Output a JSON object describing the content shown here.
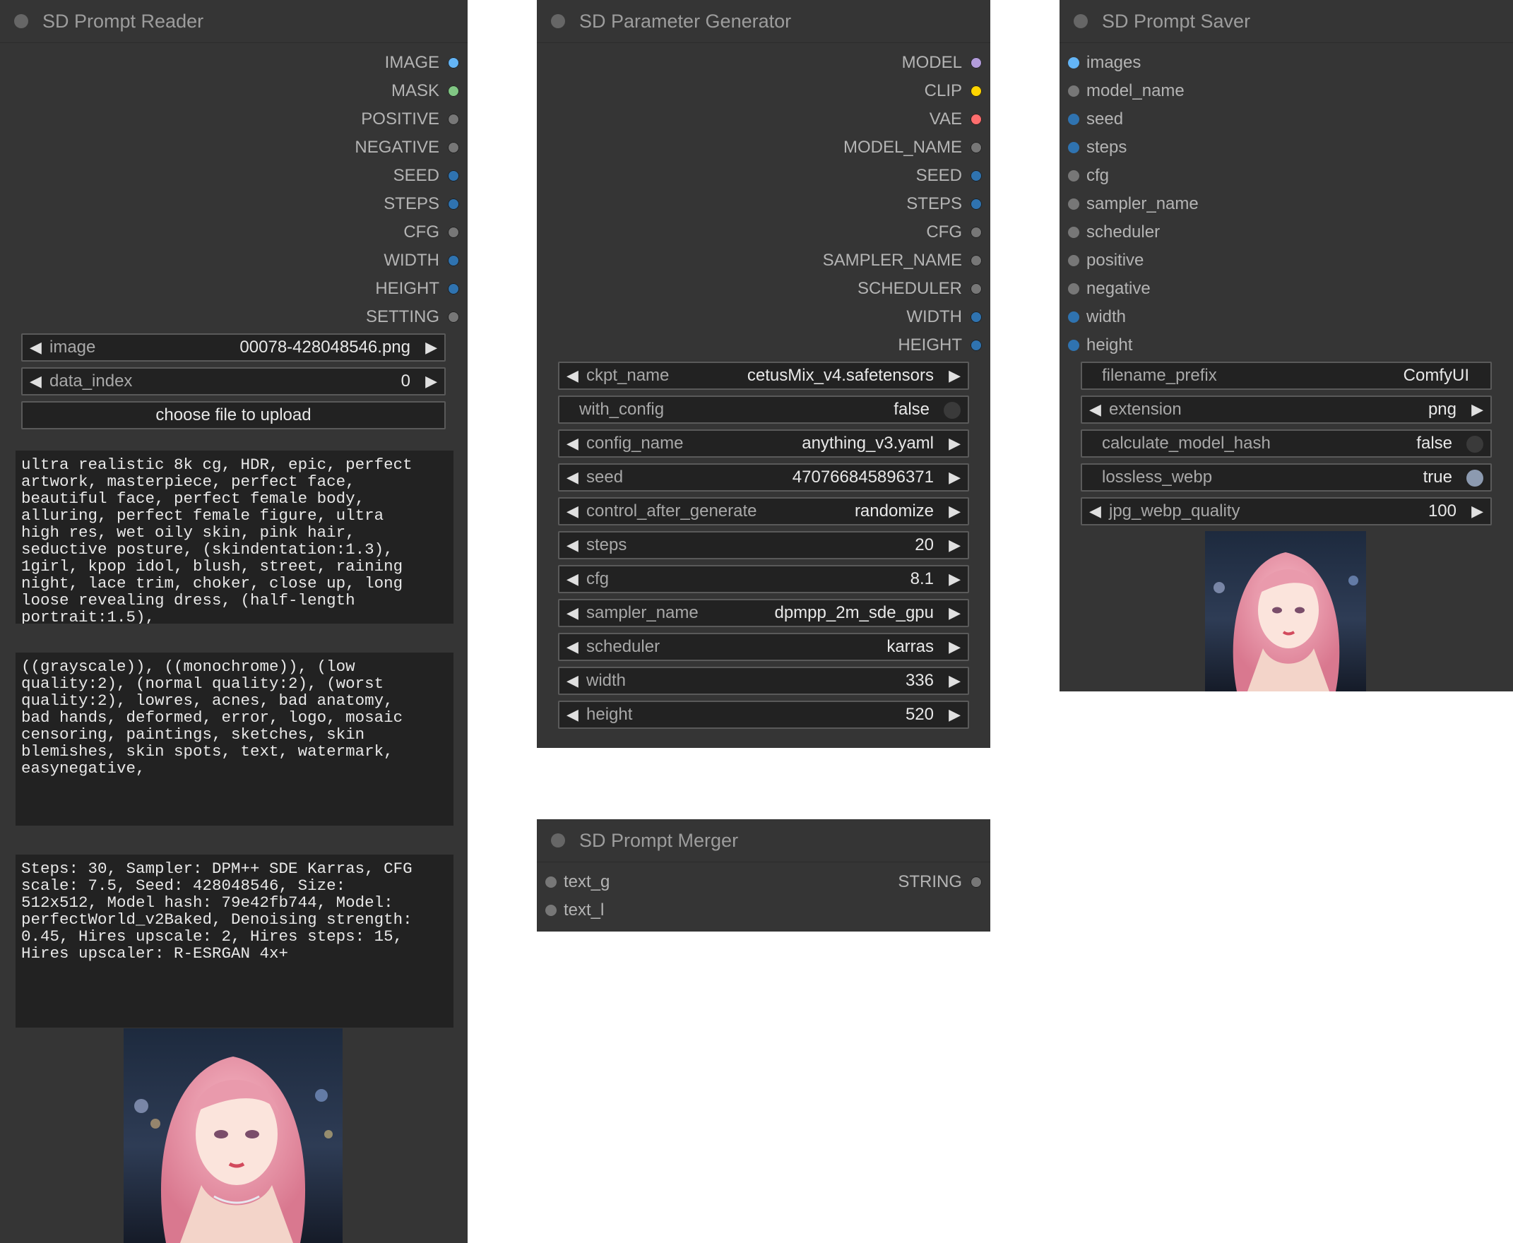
{
  "reader": {
    "title": "SD Prompt Reader",
    "outputs": [
      {
        "label": "IMAGE",
        "color": "#64b5f6"
      },
      {
        "label": "MASK",
        "color": "#81c784"
      },
      {
        "label": "POSITIVE",
        "color": "#777777"
      },
      {
        "label": "NEGATIVE",
        "color": "#777777"
      },
      {
        "label": "SEED",
        "color": "#2f73b0"
      },
      {
        "label": "STEPS",
        "color": "#2f73b0"
      },
      {
        "label": "CFG",
        "color": "#777777"
      },
      {
        "label": "WIDTH",
        "color": "#2f73b0"
      },
      {
        "label": "HEIGHT",
        "color": "#2f73b0"
      },
      {
        "label": "SETTING",
        "color": "#777777"
      }
    ],
    "widgets": {
      "image": {
        "name": "image",
        "value": "00078-428048546.png"
      },
      "data_index": {
        "name": "data_index",
        "value": "0"
      },
      "upload_label": "choose file to upload"
    },
    "positive_text": "ultra realistic 8k cg, HDR, epic, perfect\nartwork, masterpiece, perfect face,\nbeautiful face, perfect female body,\nalluring, perfect female figure, ultra\nhigh res, wet oily skin, pink hair,\nseductive posture, (skindentation:1.3),\n1girl, kpop idol, blush, street, raining\nnight, lace trim, choker, close up, long\nloose revealing dress, (half-length\nportrait:1.5),",
    "negative_text": "((grayscale)), ((monochrome)), (low\nquality:2), (normal quality:2), (worst\nquality:2), lowres, acnes, bad anatomy,\nbad hands, deformed, error, logo, mosaic\ncensoring, paintings, sketches, skin\nblemishes, skin spots, text, watermark,\neasynegative,",
    "settings_text": "Steps: 30, Sampler: DPM++ SDE Karras, CFG\nscale: 7.5, Seed: 428048546, Size:\n512x512, Model hash: 79e42fb744, Model:\nperfectWorld_v2Baked, Denoising strength:\n0.45, Hires upscale: 2, Hires steps: 15,\nHires upscaler: R-ESRGAN 4x+"
  },
  "generator": {
    "title": "SD Parameter Generator",
    "outputs": [
      {
        "label": "MODEL",
        "color": "#b39ddb"
      },
      {
        "label": "CLIP",
        "color": "#ffd500"
      },
      {
        "label": "VAE",
        "color": "#ff6e6e"
      },
      {
        "label": "MODEL_NAME",
        "color": "#777777"
      },
      {
        "label": "SEED",
        "color": "#2f73b0"
      },
      {
        "label": "STEPS",
        "color": "#2f73b0"
      },
      {
        "label": "CFG",
        "color": "#777777"
      },
      {
        "label": "SAMPLER_NAME",
        "color": "#777777"
      },
      {
        "label": "SCHEDULER",
        "color": "#777777"
      },
      {
        "label": "WIDTH",
        "color": "#2f73b0"
      },
      {
        "label": "HEIGHT",
        "color": "#2f73b0"
      }
    ],
    "widgets": [
      {
        "kind": "combo",
        "name": "ckpt_name",
        "value": "cetusMix_v4.safetensors"
      },
      {
        "kind": "toggle",
        "name": "with_config",
        "value": "false",
        "on": false
      },
      {
        "kind": "combo",
        "name": "config_name",
        "value": "anything_v3.yaml"
      },
      {
        "kind": "combo",
        "name": "seed",
        "value": "470766845896371"
      },
      {
        "kind": "combo",
        "name": "control_after_generate",
        "value": "randomize"
      },
      {
        "kind": "combo",
        "name": "steps",
        "value": "20"
      },
      {
        "kind": "combo",
        "name": "cfg",
        "value": "8.1"
      },
      {
        "kind": "combo",
        "name": "sampler_name",
        "value": "dpmpp_2m_sde_gpu"
      },
      {
        "kind": "combo",
        "name": "scheduler",
        "value": "karras"
      },
      {
        "kind": "combo",
        "name": "width",
        "value": "336"
      },
      {
        "kind": "combo",
        "name": "height",
        "value": "520"
      }
    ]
  },
  "merger": {
    "title": "SD Prompt Merger",
    "inputs": [
      {
        "label": "text_g",
        "color": "#777777"
      },
      {
        "label": "text_l",
        "color": "#777777"
      }
    ],
    "output": {
      "label": "STRING",
      "color": "#777777"
    }
  },
  "saver": {
    "title": "SD Prompt Saver",
    "inputs": [
      {
        "label": "images",
        "color": "#64b5f6"
      },
      {
        "label": "model_name",
        "color": "#777777"
      },
      {
        "label": "seed",
        "color": "#2f73b0"
      },
      {
        "label": "steps",
        "color": "#2f73b0"
      },
      {
        "label": "cfg",
        "color": "#777777"
      },
      {
        "label": "sampler_name",
        "color": "#777777"
      },
      {
        "label": "scheduler",
        "color": "#777777"
      },
      {
        "label": "positive",
        "color": "#777777"
      },
      {
        "label": "negative",
        "color": "#777777"
      },
      {
        "label": "width",
        "color": "#2f73b0"
      },
      {
        "label": "height",
        "color": "#2f73b0"
      }
    ],
    "widgets": [
      {
        "kind": "text",
        "name": "filename_prefix",
        "value": "ComfyUI"
      },
      {
        "kind": "combo",
        "name": "extension",
        "value": "png"
      },
      {
        "kind": "toggle",
        "name": "calculate_model_hash",
        "value": "false",
        "on": false
      },
      {
        "kind": "toggle",
        "name": "lossless_webp",
        "value": "true",
        "on": true
      },
      {
        "kind": "combo",
        "name": "jpg_webp_quality",
        "value": "100"
      }
    ]
  },
  "icons": {
    "arrow_left": "◀",
    "arrow_right": "▶"
  },
  "colors": {
    "node_bg": "#353535",
    "widget_bg": "#222222",
    "canvas_bg": "#ffffff"
  }
}
